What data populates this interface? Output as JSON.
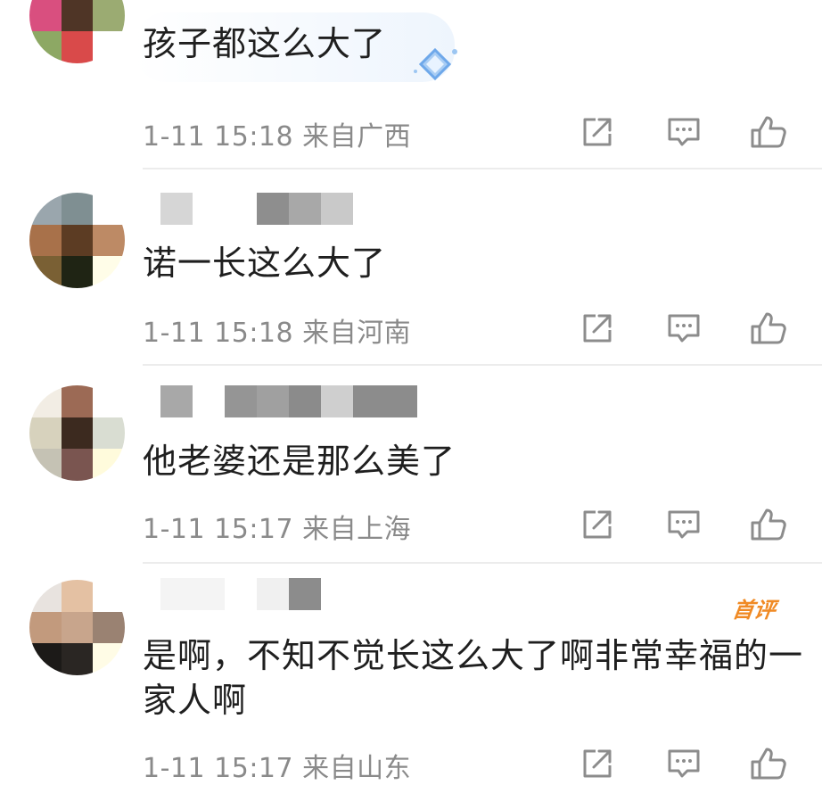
{
  "comments": [
    {
      "text": "孩子都这么大了",
      "date": "1-11",
      "time": "15:18",
      "location": "来自广西",
      "has_decoration": true
    },
    {
      "text": "诺一长这么大了",
      "date": "1-11",
      "time": "15:18",
      "location": "来自河南"
    },
    {
      "text": "他老婆还是那么美了",
      "date": "1-11",
      "time": "15:17",
      "location": "来自上海"
    },
    {
      "text": "是啊，不知不觉长这么大了啊非常幸福的一\n家人啊",
      "badge": "首评",
      "date": "1-11",
      "time": "15:17",
      "location": "来自山东"
    }
  ],
  "icons": [
    "share-icon",
    "comment-icon",
    "like-icon"
  ],
  "colors": {
    "meta": "#8a8a8a",
    "text": "#1f1f1f",
    "badge": "#f08a24",
    "icon": "#8c8c8c"
  }
}
